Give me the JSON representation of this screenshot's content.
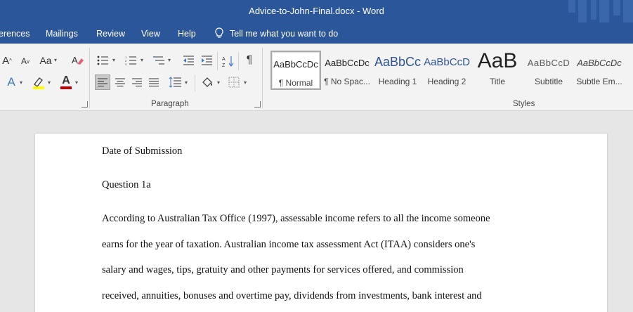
{
  "window": {
    "title": "Advice-to-John-Final.docx  -  Word"
  },
  "tabs": [
    {
      "label": "erences"
    },
    {
      "label": "Mailings"
    },
    {
      "label": "Review"
    },
    {
      "label": "View"
    },
    {
      "label": "Help"
    }
  ],
  "tell_me": {
    "text": "Tell me what you want to do"
  },
  "font_group": {
    "grow_label": "A",
    "shrink_label": "A",
    "change_case_label": "Aa",
    "text_effects_label": "A",
    "highlight_color": "#ffff00",
    "font_color_label": "A",
    "font_color": "#c00000"
  },
  "groups": {
    "paragraph": "Paragraph",
    "styles": "Styles"
  },
  "styles": [
    {
      "sample": "AaBbCcDc",
      "name": "¶ Normal"
    },
    {
      "sample": "AaBbCcDc",
      "name": "¶ No Spac..."
    },
    {
      "sample": "AaBbCc",
      "name": "Heading 1"
    },
    {
      "sample": "AaBbCcD",
      "name": "Heading 2"
    },
    {
      "sample": "AaB",
      "name": "Title"
    },
    {
      "sample": "AaBbCcD",
      "name": "Subtitle"
    },
    {
      "sample": "AaBbCcDc",
      "name": "Subtle Em..."
    }
  ],
  "document": {
    "lines": [
      "Date of Submission",
      "Question 1a",
      "According to Australian Tax Office (1997), assessable income refers to all the income someone",
      "earns for the year of taxation. Australian income tax assessment Act (ITAA) considers one's",
      "salary and wages, tips, gratuity and other payments for services offered, and commission",
      "received, annuities, bonuses and overtime pay, dividends from investments, bank interest and"
    ]
  },
  "colors": {
    "brand": "#2b579a",
    "ribbon": "#f3f3f3",
    "canvas": "#e6e6e6"
  }
}
